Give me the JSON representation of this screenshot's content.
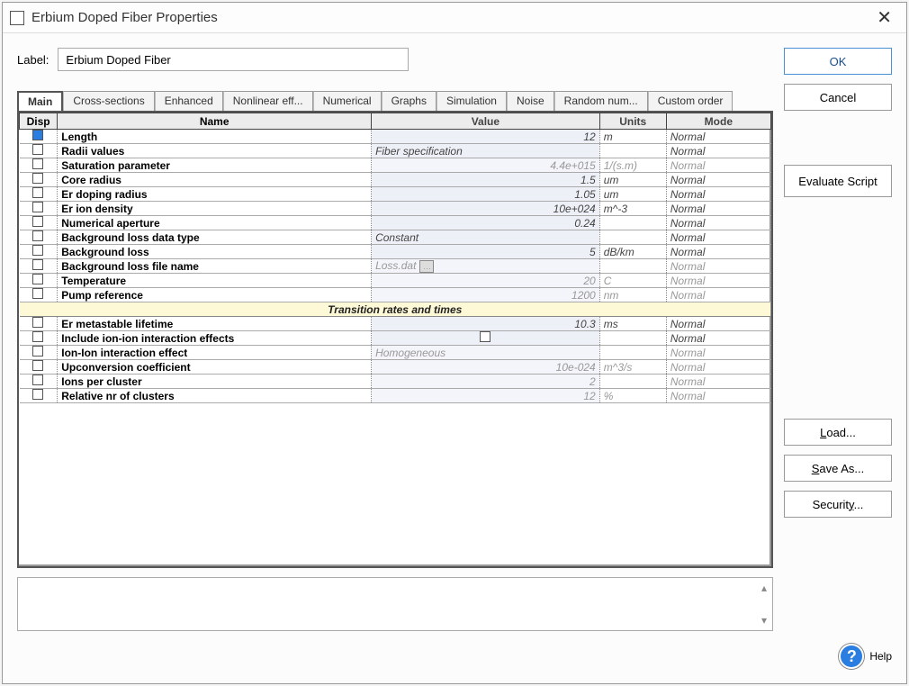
{
  "window": {
    "title": "Erbium Doped Fiber Properties"
  },
  "label_row": {
    "label": "Label:",
    "value": "Erbium Doped Fiber"
  },
  "tabs": [
    {
      "label": "Main",
      "active": true
    },
    {
      "label": "Cross-sections"
    },
    {
      "label": "Enhanced"
    },
    {
      "label": "Nonlinear eff..."
    },
    {
      "label": "Numerical"
    },
    {
      "label": "Graphs"
    },
    {
      "label": "Simulation"
    },
    {
      "label": "Noise"
    },
    {
      "label": "Random num..."
    },
    {
      "label": "Custom order"
    }
  ],
  "columns": {
    "disp": "Disp",
    "name": "Name",
    "value": "Value",
    "units": "Units",
    "mode": "Mode"
  },
  "rows": [
    {
      "disp": true,
      "name": "Length",
      "value": "12",
      "units": "m",
      "mode": "Normal"
    },
    {
      "disp": false,
      "name": "Radii values",
      "value": "Fiber specification",
      "value_align": "left",
      "units": "",
      "mode": "Normal"
    },
    {
      "disp": false,
      "name": "Saturation parameter",
      "value": "4.4e+015",
      "units": "1/(s.m)",
      "mode": "Normal",
      "disabled": true
    },
    {
      "disp": false,
      "name": "Core radius",
      "value": "1.5",
      "units": "um",
      "mode": "Normal"
    },
    {
      "disp": false,
      "name": "Er doping radius",
      "value": "1.05",
      "units": "um",
      "mode": "Normal"
    },
    {
      "disp": false,
      "name": "Er ion density",
      "value": "10e+024",
      "units": "m^-3",
      "mode": "Normal"
    },
    {
      "disp": false,
      "name": "Numerical aperture",
      "value": "0.24",
      "units": "",
      "mode": "Normal"
    },
    {
      "disp": false,
      "name": "Background loss data type",
      "value": "Constant",
      "value_align": "left",
      "units": "",
      "mode": "Normal"
    },
    {
      "disp": false,
      "name": "Background loss",
      "value": "5",
      "units": "dB/km",
      "mode": "Normal"
    },
    {
      "disp": false,
      "name": "Background loss file name",
      "value": "Loss.dat",
      "value_align": "left",
      "ellipsis": true,
      "units": "",
      "mode": "Normal",
      "disabled": true
    },
    {
      "disp": false,
      "name": "Temperature",
      "value": "20",
      "units": "C",
      "mode": "Normal",
      "disabled": true
    },
    {
      "disp": false,
      "name": "Pump reference",
      "value": "1200",
      "units": "nm",
      "mode": "Normal",
      "disabled": true
    }
  ],
  "section": {
    "label": "Transition rates and times"
  },
  "rows2": [
    {
      "disp": false,
      "name": "Er metastable lifetime",
      "value": "10.3",
      "units": "ms",
      "mode": "Normal"
    },
    {
      "disp": false,
      "name": "Include ion-ion interaction effects",
      "value_checkbox": true,
      "units": "",
      "mode": "Normal"
    },
    {
      "disp": false,
      "name": "Ion-Ion interaction effect",
      "value": "Homogeneous",
      "value_align": "left",
      "units": "",
      "mode": "Normal",
      "disabled": true
    },
    {
      "disp": false,
      "name": "Upconversion coefficient",
      "value": "10e-024",
      "units": "m^3/s",
      "mode": "Normal",
      "disabled": true
    },
    {
      "disp": false,
      "name": "Ions per cluster",
      "value": "2",
      "units": "",
      "mode": "Normal",
      "disabled": true
    },
    {
      "disp": false,
      "name": "Relative nr of clusters",
      "value": "12",
      "units": "%",
      "mode": "Normal",
      "disabled": true
    }
  ],
  "buttons": {
    "ok": "OK",
    "cancel": "Cancel",
    "evaluate": "Evaluate Script",
    "load": "Load...",
    "saveas": "Save As...",
    "security": "Security...",
    "help": "Help"
  }
}
